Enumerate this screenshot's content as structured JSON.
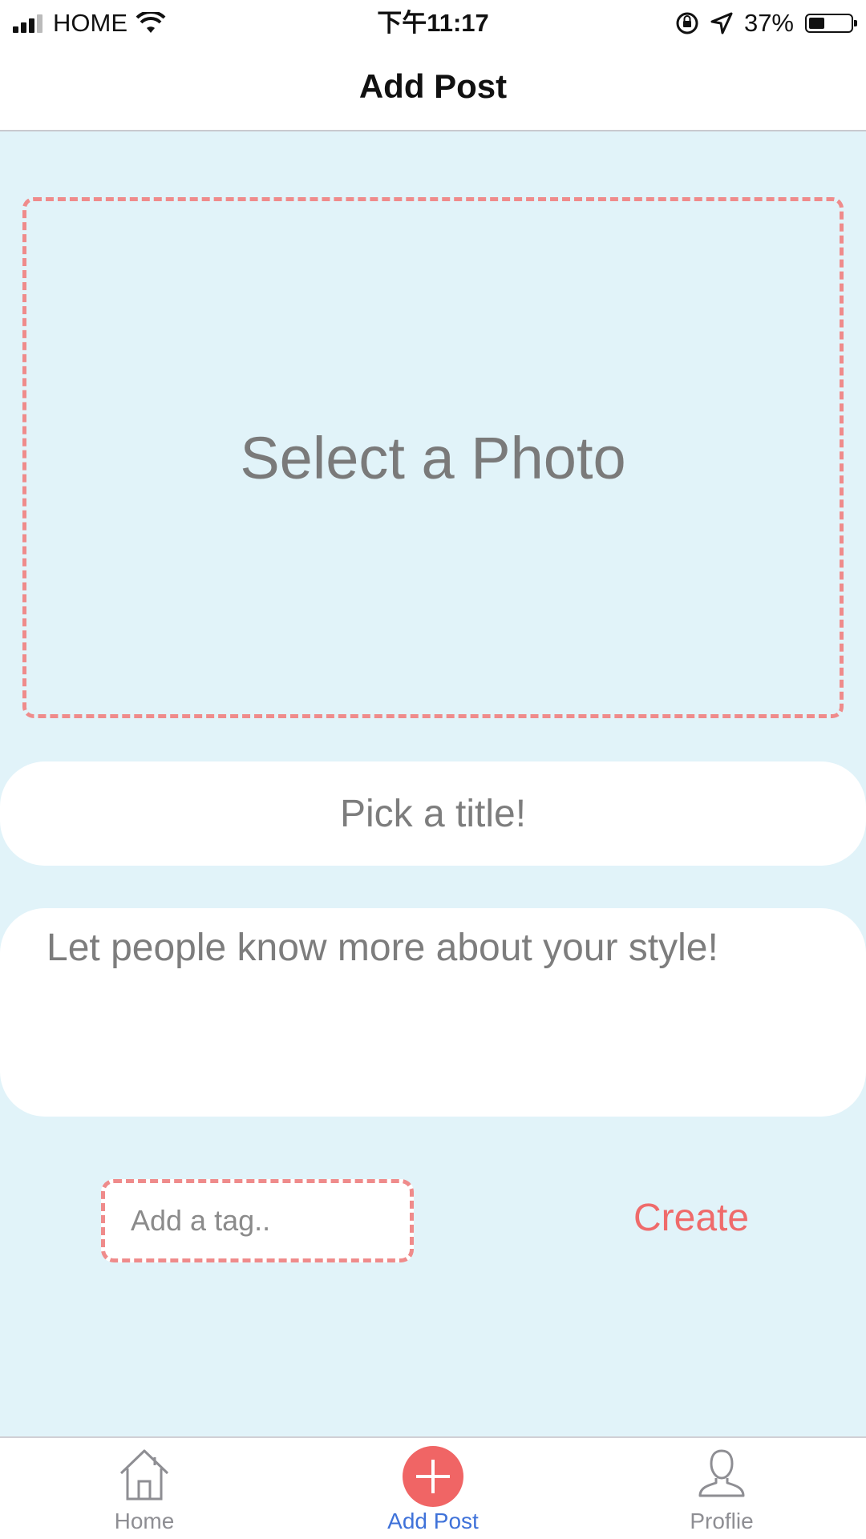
{
  "status_bar": {
    "carrier": "HOME",
    "time": "下午11:17",
    "battery": "37%",
    "battery_level": 0.37
  },
  "header": {
    "title": "Add Post"
  },
  "form": {
    "photo_prompt": "Select a Photo",
    "title_placeholder": "Pick a title!",
    "description_placeholder": "Let people know more about your style!",
    "tag_placeholder": "Add a tag..",
    "create_label": "Create"
  },
  "colors": {
    "background": "#e1f3f9",
    "accent": "#ef6b6b",
    "dashed_border": "#ef8b8b",
    "active_tab": "#3f72d9",
    "inactive_tab": "#8e8e93"
  },
  "tab_bar": {
    "items": [
      {
        "label": "Home",
        "icon": "home-icon",
        "active": false
      },
      {
        "label": "Add Post",
        "icon": "plus-circle-icon",
        "active": true
      },
      {
        "label": "Proflie",
        "icon": "person-icon",
        "active": false
      }
    ]
  }
}
